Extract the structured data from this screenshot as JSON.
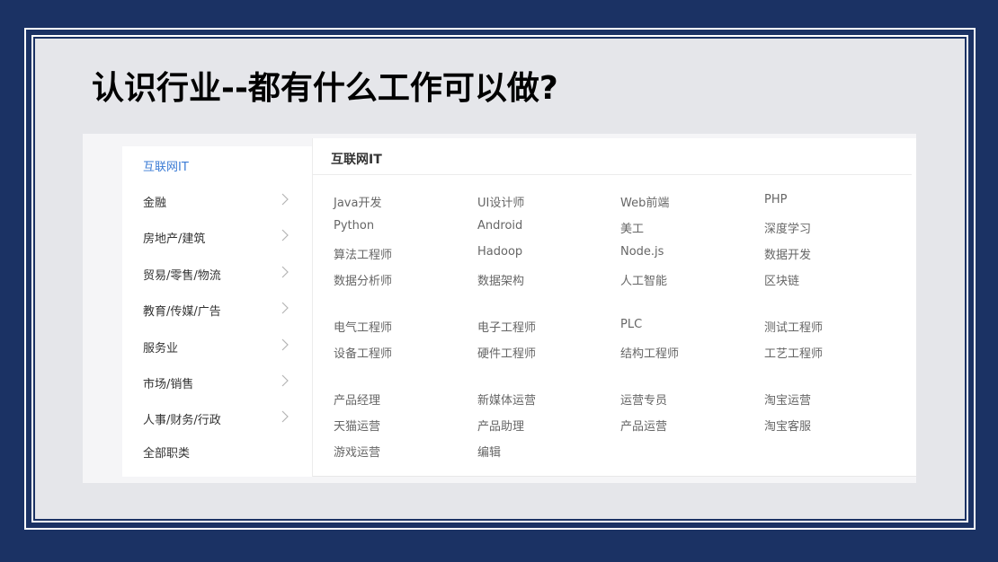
{
  "slide": {
    "title": "认识行业--都有什么工作可以做?"
  },
  "menu": {
    "items": [
      {
        "label": "互联网IT",
        "active": true,
        "chevron": false
      },
      {
        "label": "金融",
        "active": false,
        "chevron": true
      },
      {
        "label": "房地产/建筑",
        "active": false,
        "chevron": true
      },
      {
        "label": "贸易/零售/物流",
        "active": false,
        "chevron": true
      },
      {
        "label": "教育/传媒/广告",
        "active": false,
        "chevron": true
      },
      {
        "label": "服务业",
        "active": false,
        "chevron": true
      },
      {
        "label": "市场/销售",
        "active": false,
        "chevron": true
      },
      {
        "label": "人事/财务/行政",
        "active": false,
        "chevron": true
      },
      {
        "label": "全部职类",
        "active": false,
        "chevron": false
      }
    ],
    "chevron_icon": "chevron-right-icon",
    "active_color": "#3a7bd5"
  },
  "panel": {
    "title": "互联网IT",
    "groups": [
      {
        "jobs": [
          "Java开发",
          "UI设计师",
          "Web前端",
          "PHP",
          "Python",
          "Android",
          "美工",
          "深度学习",
          "算法工程师",
          "Hadoop",
          "Node.js",
          "数据开发",
          "数据分析师",
          "数据架构",
          "人工智能",
          "区块链"
        ]
      },
      {
        "jobs": [
          "电气工程师",
          "电子工程师",
          "PLC",
          "测试工程师",
          "设备工程师",
          "硬件工程师",
          "结构工程师",
          "工艺工程师"
        ]
      },
      {
        "jobs": [
          "产品经理",
          "新媒体运营",
          "运营专员",
          "淘宝运营",
          "天猫运营",
          "产品助理",
          "产品运营",
          "淘宝客服",
          "游戏运营",
          "编辑"
        ]
      }
    ]
  },
  "colors": {
    "background": "#1b3264",
    "slide": "#e5e6ea",
    "job_text": "#666666"
  }
}
